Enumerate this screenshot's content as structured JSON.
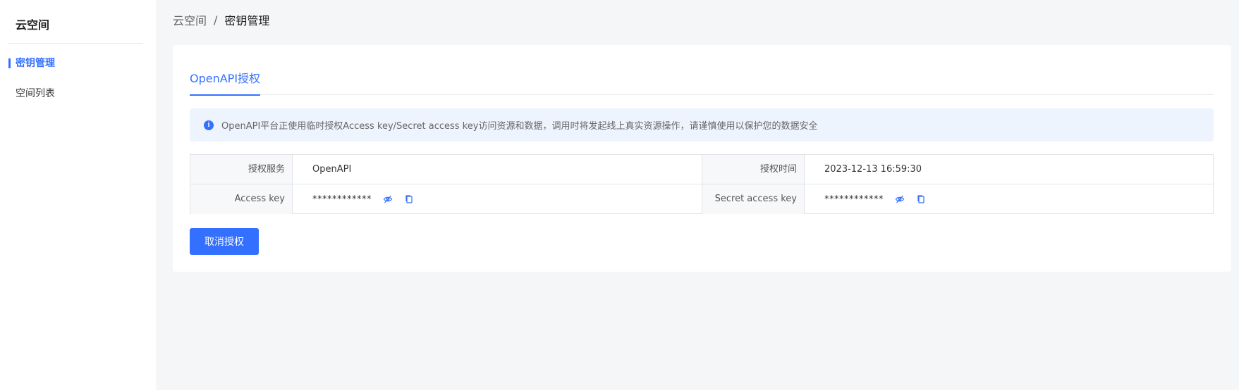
{
  "sidebar": {
    "title": "云空间",
    "items": [
      {
        "label": "密钥管理"
      },
      {
        "label": "空间列表"
      }
    ]
  },
  "breadcrumb": {
    "root": "云空间",
    "separator": "/",
    "current": "密钥管理"
  },
  "tabs": [
    {
      "label": "OpenAPI授权"
    }
  ],
  "alert": {
    "icon": "info-icon",
    "text": "OpenAPI平台正使用临时授权Access key/Secret access key访问资源和数据，调用时将发起线上真实资源操作，请谨慎使用以保护您的数据安全"
  },
  "info_table": {
    "service_label": "授权服务",
    "service_value": "OpenAPI",
    "time_label": "授权时间",
    "time_value": "2023-12-13 16:59:30",
    "access_key_label": "Access key",
    "access_key_value": "************",
    "secret_key_label": "Secret access key",
    "secret_key_value": "************"
  },
  "actions": {
    "revoke_label": "取消授权"
  },
  "colors": {
    "accent": "#3370ff",
    "alert_bg": "#eef4fd",
    "page_bg": "#f5f6f8"
  }
}
